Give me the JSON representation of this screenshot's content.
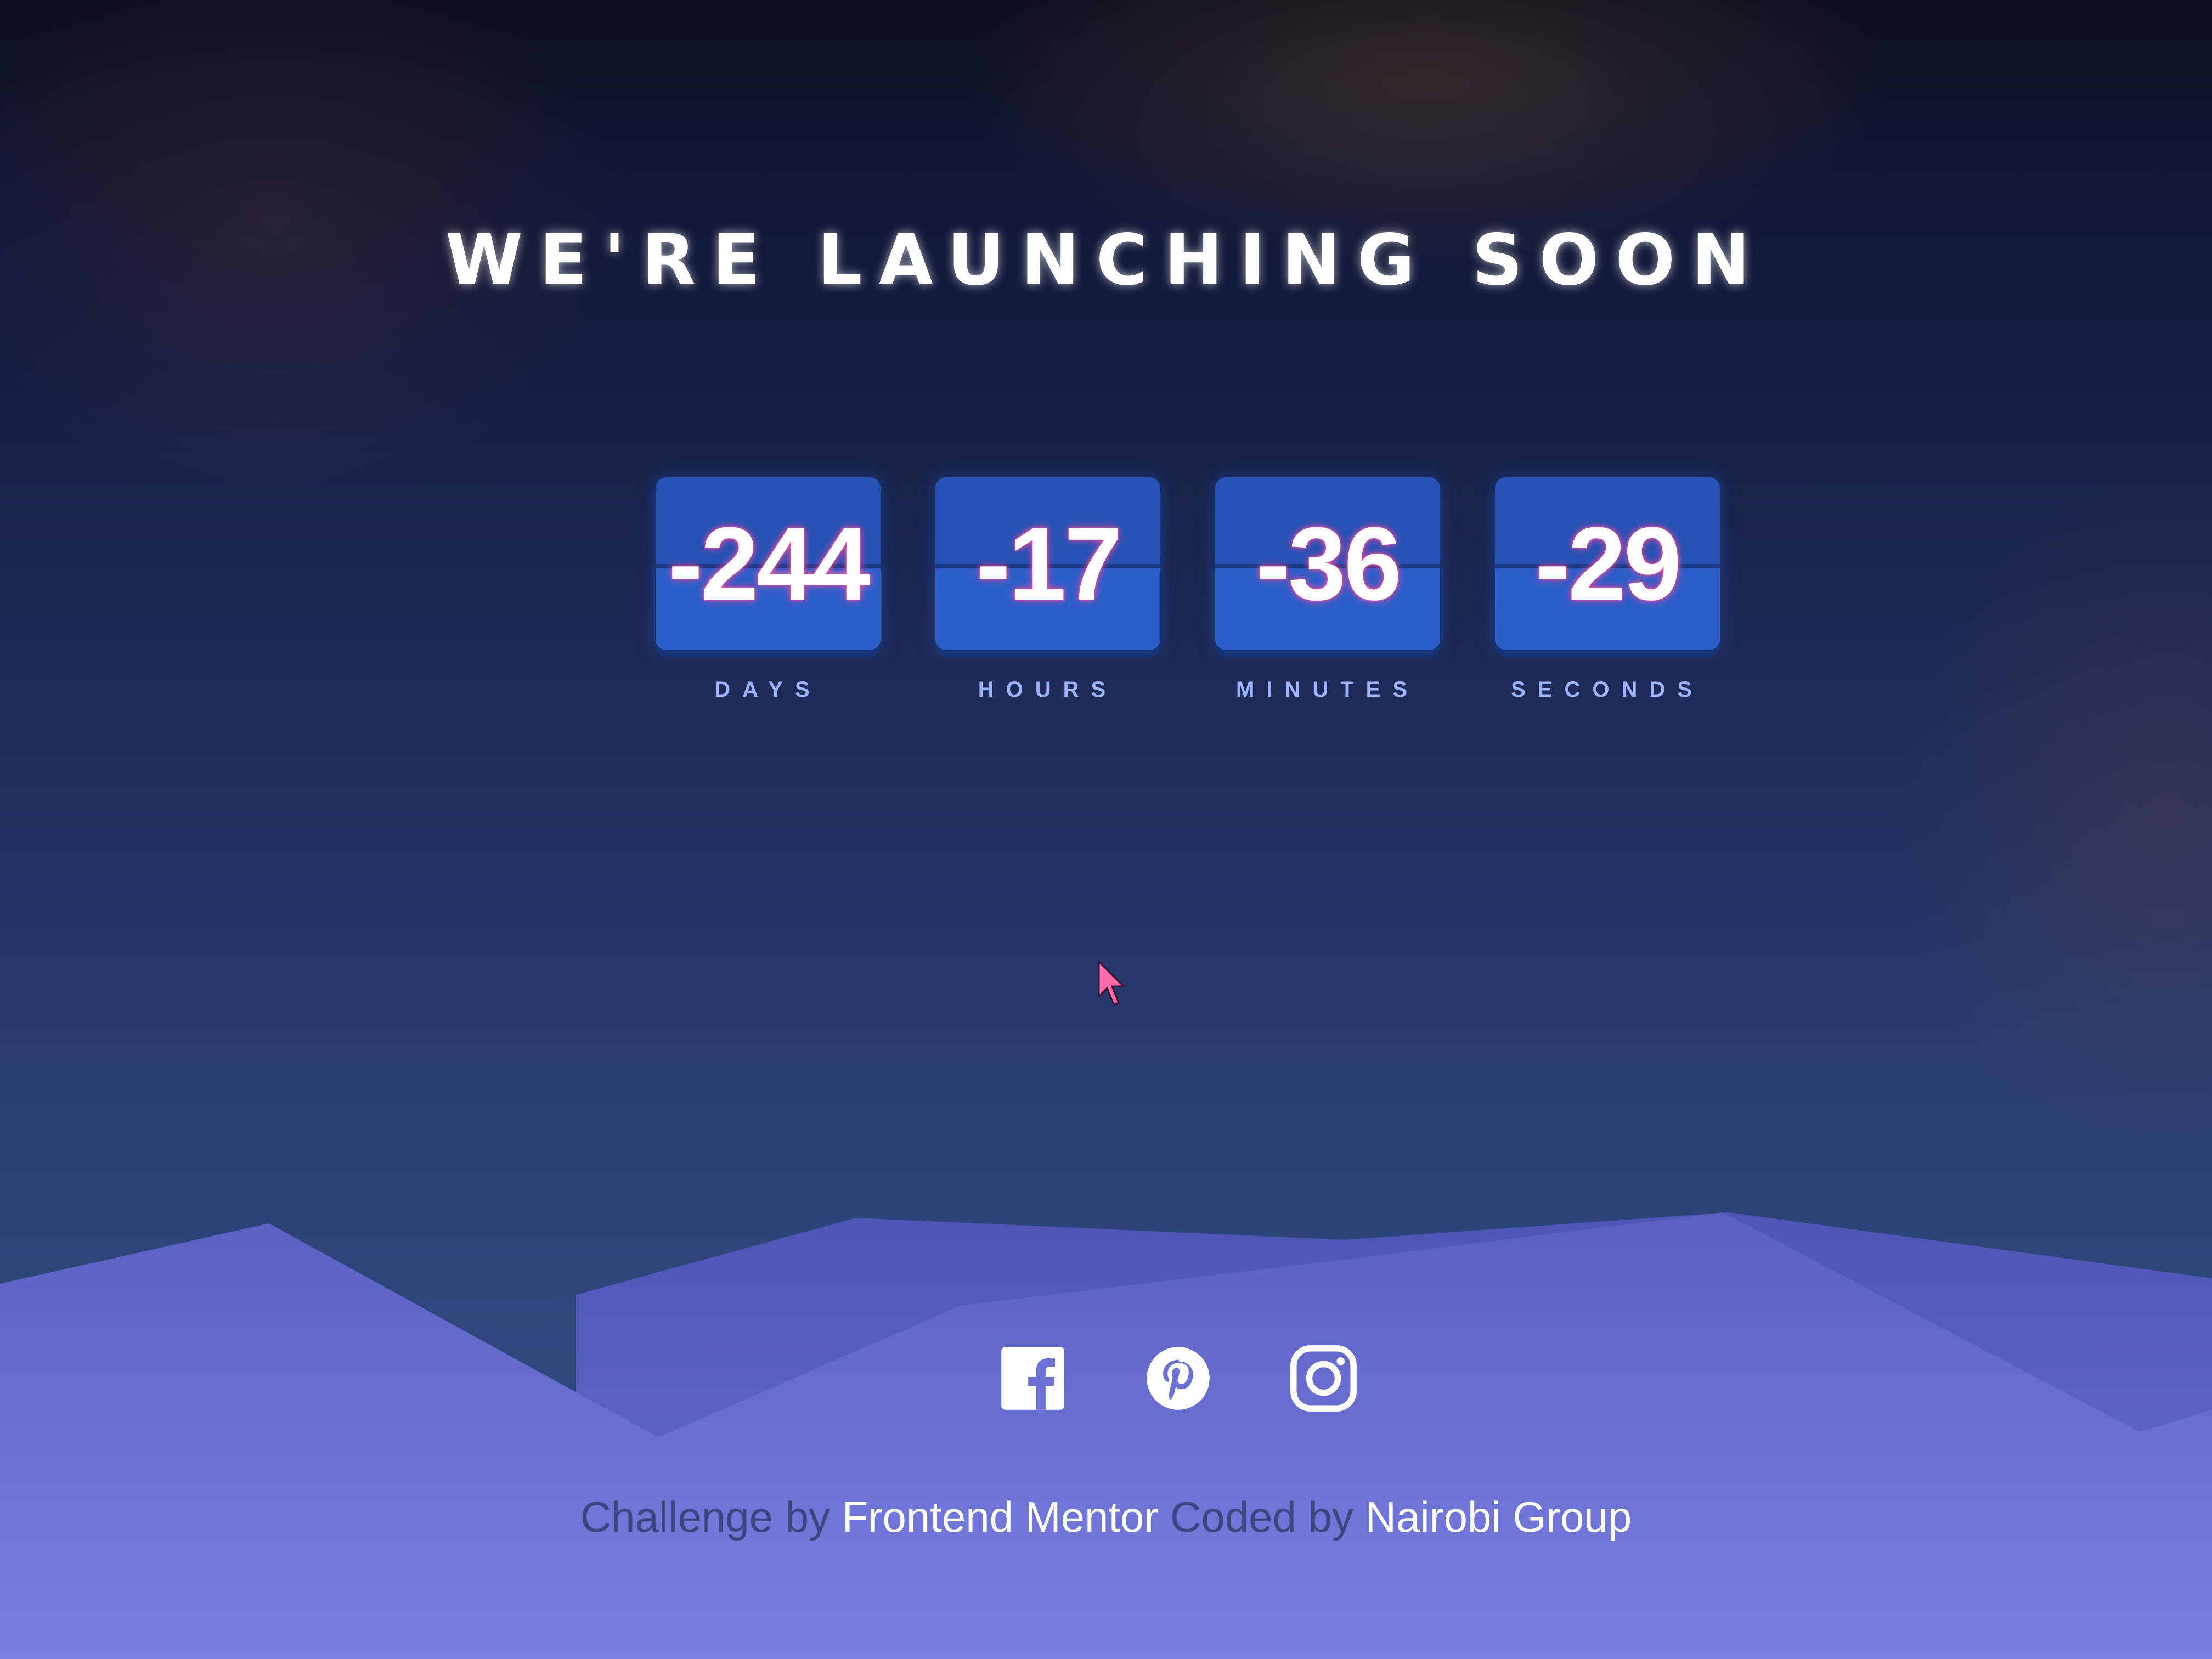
{
  "title": "WE'RE LAUNCHING SOON",
  "countdown": [
    {
      "value": "-244",
      "label": "DAYS"
    },
    {
      "value": "-17",
      "label": "HOURS"
    },
    {
      "value": "-36",
      "label": "MINUTES"
    },
    {
      "value": "-29",
      "label": "SECONDS"
    }
  ],
  "socials": [
    {
      "icon": "facebook-icon"
    },
    {
      "icon": "pinterest-icon"
    },
    {
      "icon": "instagram-icon"
    }
  ],
  "footer": {
    "challenge_text": "Challenge by",
    "challenge_link": "Frontend Mentor",
    "coded_text": "Coded by",
    "coded_link": "Nairobi Group"
  },
  "colors": {
    "card": "#2c5ec8",
    "digit_glow": "#ff4aa0",
    "label": "#9fb4ff",
    "mountains": "#7478d8"
  }
}
